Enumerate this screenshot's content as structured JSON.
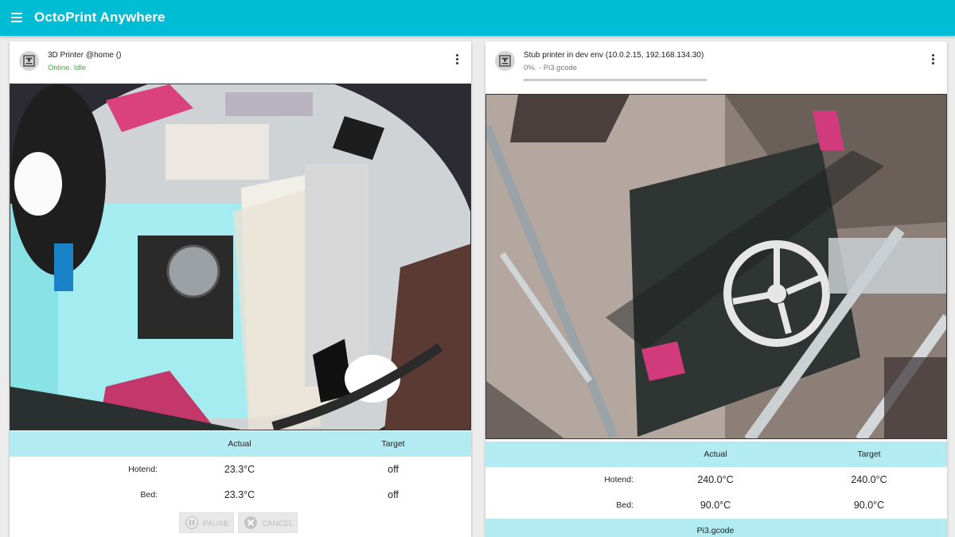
{
  "app": {
    "title": "OctoPrint Anywhere"
  },
  "colors": {
    "topbar": "#00bcd4",
    "table_header": "#b2ebf2",
    "online_status": "#2eb82e"
  },
  "icons": {
    "menu": "hamburger-menu-icon",
    "more": "kebab-menu-icon",
    "printer": "printer-avatar-icon",
    "pause": "pause-icon",
    "cancel": "cancel-icon"
  },
  "printers": [
    {
      "name": "3D Printer @home ()",
      "status": "Online. Idle",
      "table": {
        "actual_header": "Actual",
        "target_header": "Target",
        "rows": [
          {
            "label": "Hotend:",
            "actual": "23.3°C",
            "target": "off"
          },
          {
            "label": "Bed:",
            "actual": "23.3°C",
            "target": "off"
          }
        ]
      },
      "buttons": {
        "pause": "PAUSE",
        "cancel": "CANCEL"
      }
    },
    {
      "name": "Stub printer in dev env (10.0.2.15, 192.168.134.30)",
      "status": "0%. - Pi3.gcode",
      "progress_percent": 0,
      "table": {
        "actual_header": "Actual",
        "target_header": "Target",
        "rows": [
          {
            "label": "Hotend:",
            "actual": "240.0°C",
            "target": "240.0°C"
          },
          {
            "label": "Bed:",
            "actual": "90.0°C",
            "target": "90.0°C"
          }
        ]
      },
      "job_file": "Pi3.gcode"
    }
  ]
}
